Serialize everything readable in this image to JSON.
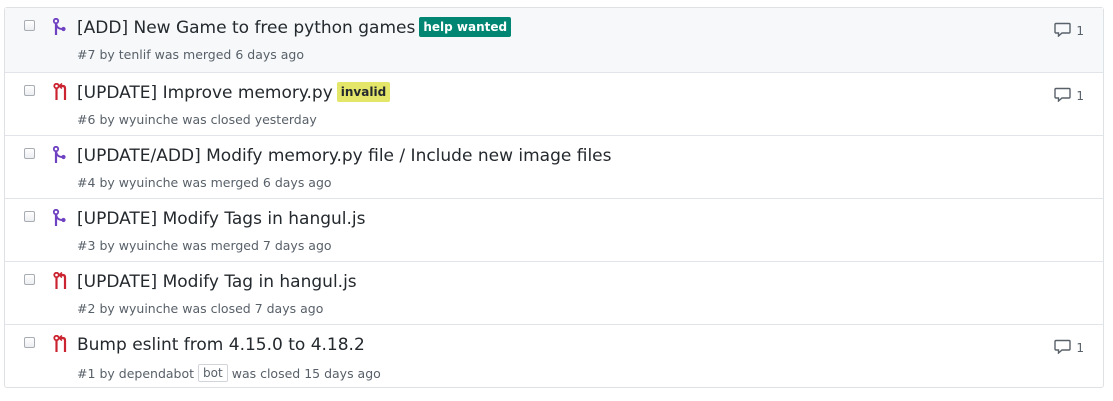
{
  "colors": {
    "merged": "#6f42c1",
    "closed": "#cb2431"
  },
  "pull_requests": [
    {
      "state": "merged",
      "icon": "git-merge-icon",
      "title": "[ADD] New Game to free python games",
      "label": {
        "text": "help wanted",
        "bg": "#008672",
        "fg": "#ffffff"
      },
      "number": "#7",
      "by": "by",
      "author": "tenlif",
      "bot": "",
      "status_text": "was merged 6 days ago",
      "comments": "1"
    },
    {
      "state": "closed",
      "icon": "git-pull-request-closed-icon",
      "title": "[UPDATE] Improve memory.py",
      "label": {
        "text": "invalid",
        "bg": "#e4e669",
        "fg": "#24292e"
      },
      "number": "#6",
      "by": "by",
      "author": "wyuinche",
      "bot": "",
      "status_text": "was closed yesterday",
      "comments": "1"
    },
    {
      "state": "merged",
      "icon": "git-merge-icon",
      "title": "[UPDATE/ADD] Modify memory.py file / Include new image files",
      "label": null,
      "number": "#4",
      "by": "by",
      "author": "wyuinche",
      "bot": "",
      "status_text": "was merged 6 days ago",
      "comments": ""
    },
    {
      "state": "merged",
      "icon": "git-merge-icon",
      "title": "[UPDATE] Modify Tags in hangul.js",
      "label": null,
      "number": "#3",
      "by": "by",
      "author": "wyuinche",
      "bot": "",
      "status_text": "was merged 7 days ago",
      "comments": ""
    },
    {
      "state": "closed",
      "icon": "git-pull-request-closed-icon",
      "title": "[UPDATE] Modify Tag in hangul.js",
      "label": null,
      "number": "#2",
      "by": "by",
      "author": "wyuinche",
      "bot": "",
      "status_text": "was closed 7 days ago",
      "comments": ""
    },
    {
      "state": "closed",
      "icon": "git-pull-request-closed-icon",
      "title": "Bump eslint from 4.15.0 to 4.18.2",
      "label": null,
      "number": "#1",
      "by": "by",
      "author": "dependabot",
      "bot": "bot",
      "status_text": "was closed 15 days ago",
      "comments": "1"
    }
  ]
}
